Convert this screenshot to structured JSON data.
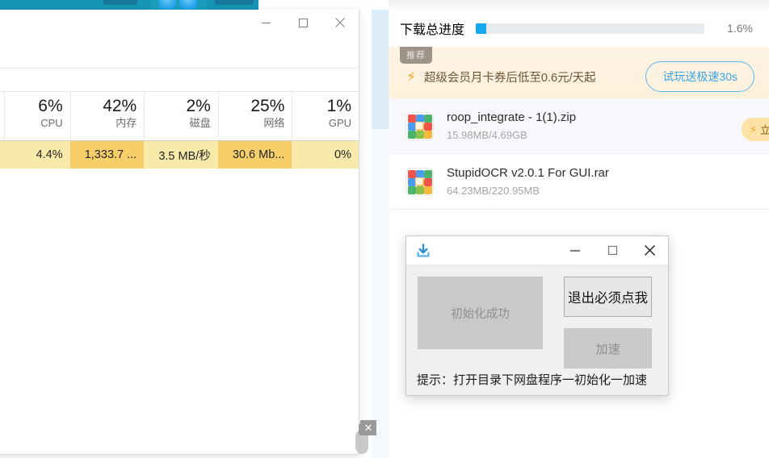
{
  "desktop": {
    "taskbar_color": "#1794b5",
    "logo_name": "browser-logo"
  },
  "task_manager": {
    "window_name": "task-manager",
    "titlebar": {
      "minimize_label": "—",
      "maximize_label": "□",
      "close_label": "✕"
    },
    "columns": [
      {
        "pct": "6%",
        "name": "CPU",
        "value": "4.4%",
        "highlight": "light"
      },
      {
        "pct": "42%",
        "name": "内存",
        "value": "1,333.7 ...",
        "highlight": "strong"
      },
      {
        "pct": "2%",
        "name": "磁盘",
        "value": "3.5 MB/秒",
        "highlight": "light"
      },
      {
        "pct": "25%",
        "name": "网络",
        "value": "30.6 Mb...",
        "highlight": "strong"
      },
      {
        "pct": "1%",
        "name": "GPU",
        "value": "0%",
        "highlight": "light"
      }
    ],
    "highlight_colors": {
      "light": "#f8eaa8",
      "strong": "#f6ce6a"
    },
    "stray_close_label": "✕"
  },
  "downloader": {
    "panel_name": "download-manager-panel",
    "progress": {
      "label": "下载总进度",
      "percent_text": "1.6%",
      "percent_value": 1.6,
      "bar_color": "#17a6f0",
      "track_color": "#e7eaef"
    },
    "ad": {
      "badge": "推荐",
      "bolt_icon": "⚡",
      "text": "超级会员月卡券后低至0.6元/天起",
      "cta_label": "试玩送极速30s",
      "cta_color": "#3ba6e6",
      "bg_color": "#fdf2e0"
    },
    "files": [
      {
        "name": "roop_integrate - 1(1).zip",
        "size": "15.98MB/4.69GB",
        "selected": true,
        "action_label": "立",
        "action_bolt": "⚡"
      },
      {
        "name": "StupidOCR v2.0.1 For GUI.rar",
        "size": "64.23MB/220.95MB",
        "selected": false,
        "action_label": "",
        "action_bolt": ""
      }
    ]
  },
  "dialog": {
    "window_name": "accelerator-dialog",
    "icon_name": "download-icon",
    "titlebar": {
      "minimize_label": "—",
      "maximize_label": "□",
      "close_label": "✕"
    },
    "status_button_label": "初始化成功",
    "exit_button_label": "退出必须点我",
    "speed_button_label": "加速",
    "hint": "提示：打开目录下网盘程序一初始化一加速"
  }
}
